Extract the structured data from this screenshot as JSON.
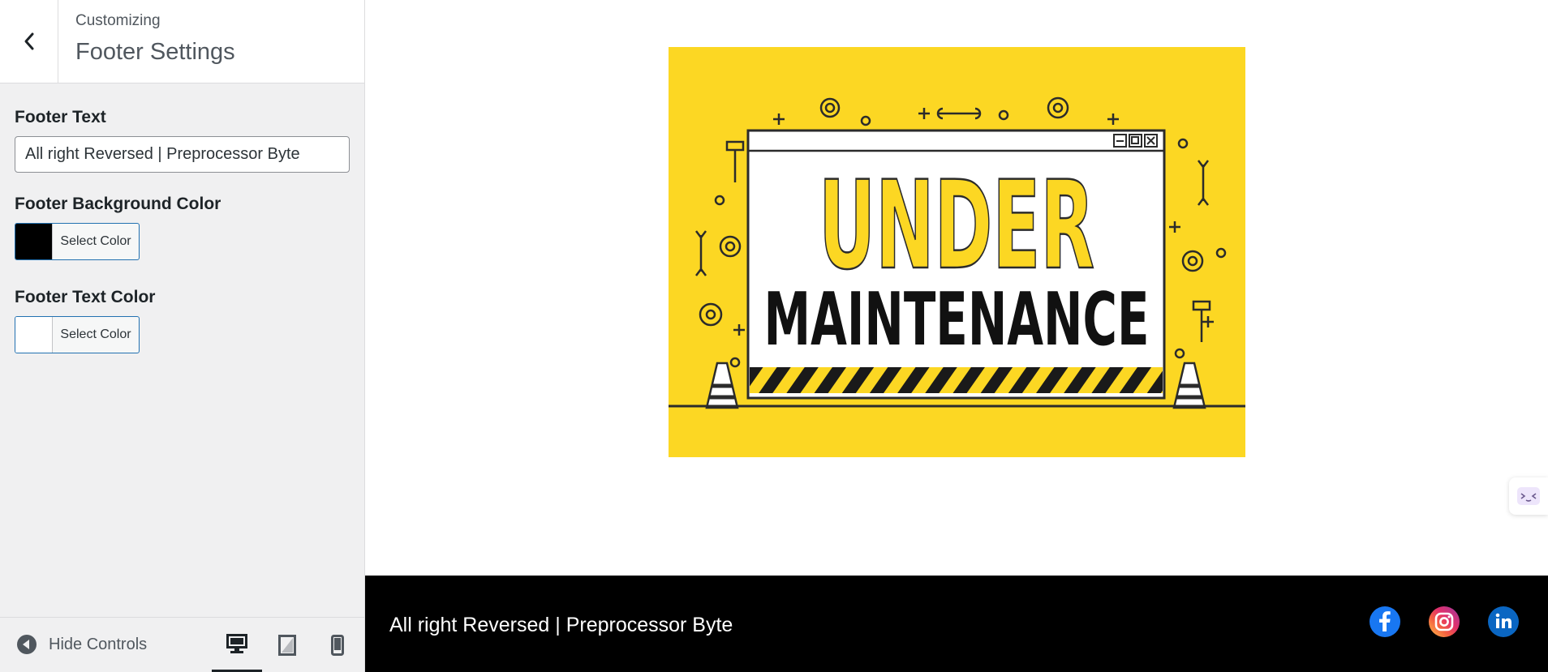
{
  "header": {
    "subtitle": "Customizing",
    "title": "Footer Settings"
  },
  "controls": {
    "footer_text_label": "Footer Text",
    "footer_text_value": "All right Reversed | Preprocessor Byte",
    "bg_color_label": "Footer Background Color",
    "bg_color_button": "Select Color",
    "bg_color_value": "#000000",
    "text_color_label": "Footer Text Color",
    "text_color_button": "Select Color",
    "text_color_value": "#ffffff"
  },
  "bottom_bar": {
    "hide_controls": "Hide Controls",
    "devices": [
      "desktop-icon",
      "tablet-icon",
      "mobile-icon"
    ],
    "active_device": "desktop"
  },
  "preview": {
    "banner": {
      "line1": "UNDER",
      "line2": "MAINTENANCE",
      "background": "#fcd723"
    },
    "footer": {
      "text": "All right Reversed | Preprocessor Byte",
      "background": "#000000",
      "social": [
        "facebook-icon",
        "instagram-icon",
        "linkedin-icon"
      ]
    }
  },
  "colors": {
    "accent": "#2271b1",
    "sidebar_bg": "#f0f0f1",
    "facebook": "#1877f2",
    "linkedin": "#0a66c2"
  }
}
